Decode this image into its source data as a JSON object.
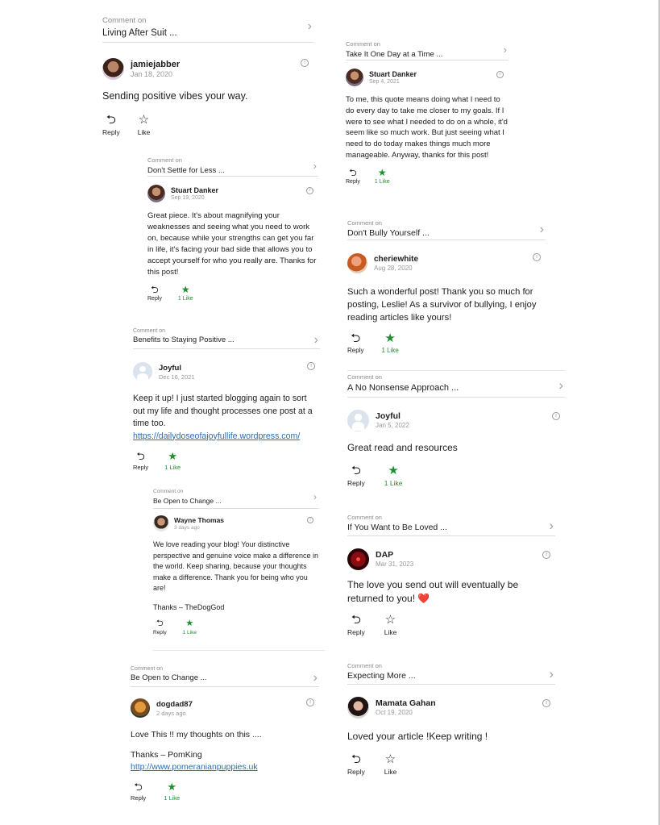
{
  "labels": {
    "comment_on": "Comment on",
    "reply": "Reply",
    "like": "Like",
    "one_like": "1 Like"
  },
  "colors": {
    "liked": "#1d8f2f",
    "link": "#2a6db5"
  },
  "icons": {
    "reply": "reply-arrow-icon",
    "like": "star-outline-icon",
    "liked": "star-filled-icon",
    "chevron": "chevron-right-icon",
    "info": "info-icon"
  },
  "comments": [
    {
      "post": "Living After Suit ...",
      "author": "jamiejabber",
      "date": "Jan 18, 2020",
      "body": [
        "Sending positive vibes your way."
      ],
      "like_label": "Like"
    },
    {
      "post": "Take It One Day at a Time ...",
      "author": "Stuart Danker",
      "date": "Sep 4, 2021",
      "body": [
        "To me, this quote means doing what I need to do every day to take me closer to my goals. If I were to see what I needed to do on a whole, it'd seem like so much work. But just seeing what I need to do today makes things much more manageable. Anyway, thanks for this post!"
      ],
      "like_label": "1 Like"
    },
    {
      "post": "Don't Settle for Less ...",
      "author": "Stuart Danker",
      "date": "Sep 19, 2020",
      "body": [
        "Great piece. It's about magnifying your weaknesses and seeing what you need to work on, because while your strengths can get you far in life, it's facing your bad side that allows you to accept yourself for who you really are. Thanks for this post!"
      ],
      "like_label": "1 Like"
    },
    {
      "post": "Don't Bully Yourself ...",
      "author": "cheriewhite",
      "date": "Aug 28, 2020",
      "body": [
        "Such a wonderful post! Thank you so much for posting, Leslie! As a survivor of bullying, I enjoy reading articles like yours!"
      ],
      "like_label": "1 Like"
    },
    {
      "post": "Benefits to Staying Positive ...",
      "author": "Joyful",
      "date": "Dec 16, 2021",
      "body": [
        "Keep it up! I just started blogging again to sort out my life and thought processes one post at a time too."
      ],
      "link": "https://dailydoseofajoyfullife.wordpress.com/",
      "like_label": "1 Like"
    },
    {
      "post": "A No Nonsense Approach ...",
      "author": "Joyful",
      "date": "Jan 5, 2022",
      "body": [
        "Great read and resources"
      ],
      "like_label": "1 Like"
    },
    {
      "post": "Be Open to Change ...",
      "author": "Wayne Thomas",
      "date": "3 days ago",
      "body": [
        "We love reading your blog! Your distinctive perspective and genuine voice make a difference in the world. Keep sharing, because your thoughts make a difference. Thank you for being who you are!",
        "Thanks – TheDogGod"
      ],
      "like_label": "1 Like"
    },
    {
      "post": "If You Want to Be Loved ...",
      "author": "DAP",
      "date": "Mar 31, 2023",
      "body": [
        "The love you send out will eventually be returned to you! ❤️"
      ],
      "like_label": "Like"
    },
    {
      "post": "Be Open to Change ...",
      "author": "dogdad87",
      "date": "2 days ago",
      "body": [
        "Love This !! my thoughts on this ....",
        "Thanks – PomKing"
      ],
      "link": "http://www.pomeranianpuppies.uk",
      "like_label": "1 Like"
    },
    {
      "post": "Expecting More ...",
      "author": "Mamata Gahan",
      "date": "Oct 19, 2020",
      "body": [
        "Loved your article !Keep writing !"
      ],
      "like_label": "Like"
    }
  ]
}
